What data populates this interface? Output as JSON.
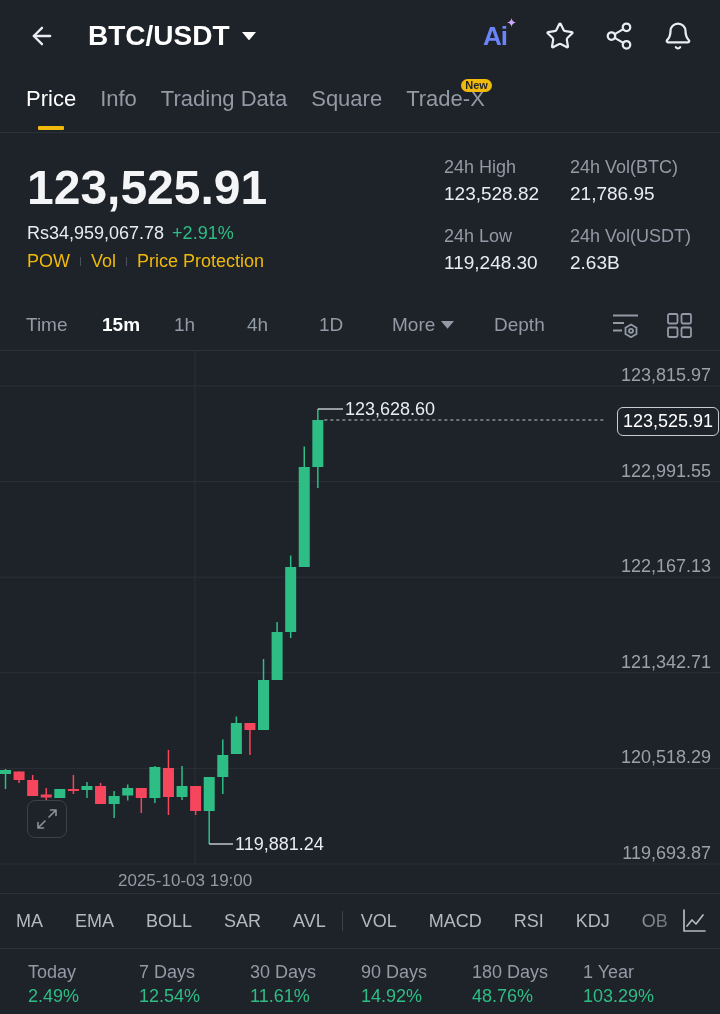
{
  "header": {
    "title": "BTC/USDT",
    "ai_label": "Ai"
  },
  "tabs": [
    {
      "label": "Price",
      "selected": true
    },
    {
      "label": "Info",
      "selected": false
    },
    {
      "label": "Trading Data",
      "selected": false
    },
    {
      "label": "Square",
      "selected": false
    },
    {
      "label": "Trade-X",
      "selected": false,
      "badge": "New"
    }
  ],
  "ticker": {
    "last_price": "123,525.91",
    "fiat_price": "Rs34,959,067.78",
    "change": "+2.91%",
    "tags": [
      "POW",
      "Vol",
      "Price Protection"
    ],
    "stats": [
      {
        "label": "24h High",
        "value": "123,528.82"
      },
      {
        "label": "24h Vol(BTC)",
        "value": "21,786.95"
      },
      {
        "label": "24h Low",
        "value": "119,248.30"
      },
      {
        "label": "24h Vol(USDT)",
        "value": "2.63B"
      }
    ]
  },
  "chart_toolbar": [
    {
      "label": "Time",
      "kind": "text",
      "selected": false
    },
    {
      "label": "15m",
      "kind": "text",
      "selected": true
    },
    {
      "label": "1h",
      "kind": "text",
      "selected": false
    },
    {
      "label": "4h",
      "kind": "text",
      "selected": false
    },
    {
      "label": "1D",
      "kind": "text",
      "selected": false
    },
    {
      "label": "More",
      "kind": "menu",
      "selected": false
    },
    {
      "label": "Depth",
      "kind": "text",
      "selected": false
    }
  ],
  "chart": {
    "y_axis_labels": [
      "123,815.97",
      "122,991.55",
      "122,167.13",
      "121,342.71",
      "120,518.29",
      "119,693.87"
    ],
    "high_label": "123,628.60",
    "low_label": "119,881.24",
    "last_price_tag": "123,525.91",
    "time_label": "2025-10-03 19:00"
  },
  "indicators": {
    "main": [
      "MA",
      "EMA",
      "BOLL",
      "SAR",
      "AVL"
    ],
    "sub": [
      "VOL",
      "MACD",
      "RSI",
      "KDJ",
      "OB"
    ]
  },
  "performance": [
    {
      "period": "Today",
      "change": "2.49%"
    },
    {
      "period": "7 Days",
      "change": "12.54%"
    },
    {
      "period": "30 Days",
      "change": "11.61%"
    },
    {
      "period": "90 Days",
      "change": "14.92%"
    },
    {
      "period": "180 Days",
      "change": "48.76%"
    },
    {
      "period": "1 Year",
      "change": "103.29%"
    }
  ]
}
